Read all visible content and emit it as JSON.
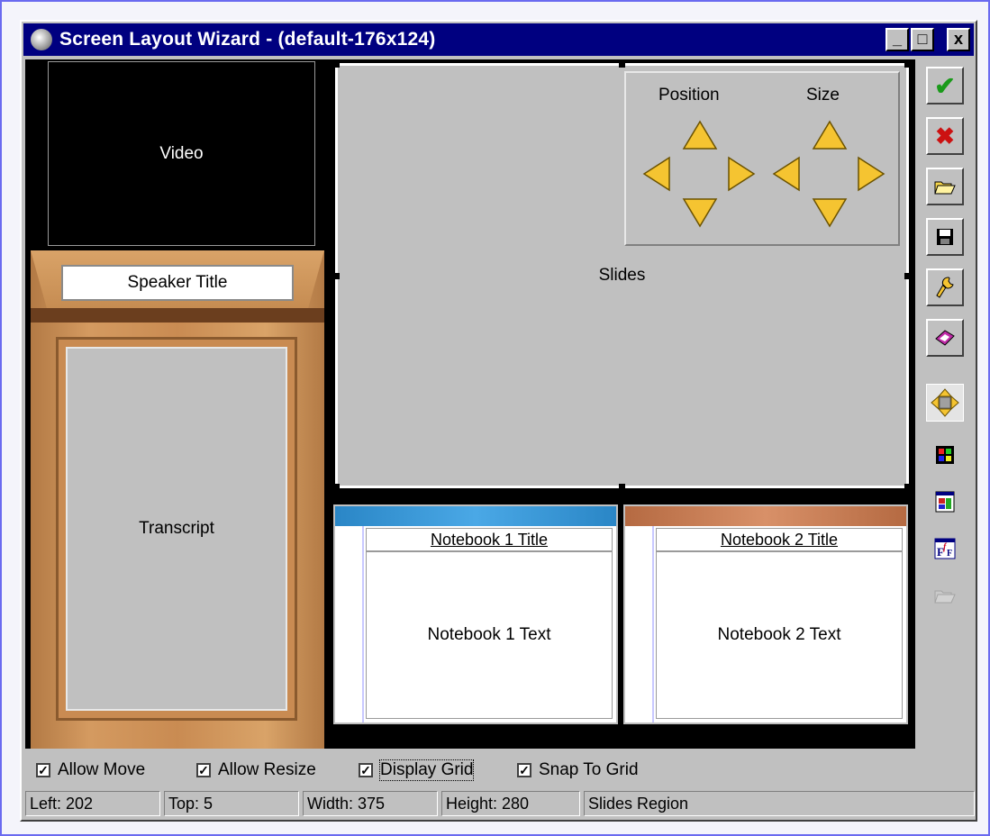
{
  "window": {
    "title": "Screen Layout Wizard - (default-176x124)",
    "controls": {
      "minimize": "_",
      "maximize": "□",
      "close": "x"
    }
  },
  "regions": {
    "video": "Video",
    "speaker_title": "Speaker Title",
    "transcript": "Transcript",
    "slides": "Slides",
    "notebook1": {
      "title": "Notebook 1 Title",
      "text": "Notebook 1 Text"
    },
    "notebook2": {
      "title": "Notebook 2 Title",
      "text": "Notebook 2 Text"
    }
  },
  "adjust_panel": {
    "position_label": "Position",
    "size_label": "Size"
  },
  "toolbar": {
    "icons": [
      "checkmark-icon",
      "close-x-icon",
      "open-folder-icon",
      "save-disk-icon",
      "wrench-icon",
      "book-icon",
      "move-arrows-icon",
      "color-grid-icon",
      "window-layout-icon",
      "font-icon",
      "disabled-folder-icon"
    ],
    "check_glyph": "✔",
    "x_glyph": "✖"
  },
  "options": {
    "allow_move": "Allow Move",
    "allow_resize": "Allow Resize",
    "display_grid": "Display Grid",
    "snap_to_grid": "Snap To Grid",
    "checked_glyph": "✓"
  },
  "status": {
    "left": "Left: 202",
    "top": "Top: 5",
    "width": "Width: 375",
    "height": "Height: 280",
    "region": "Slides Region"
  },
  "colors": {
    "titlebar": "#000080",
    "arrow_fill": "#f5c431",
    "check_green": "#1a9a1a",
    "x_red": "#cc1111",
    "notebook1_bar": "#3a9ad8",
    "notebook2_bar": "#c07a52"
  }
}
